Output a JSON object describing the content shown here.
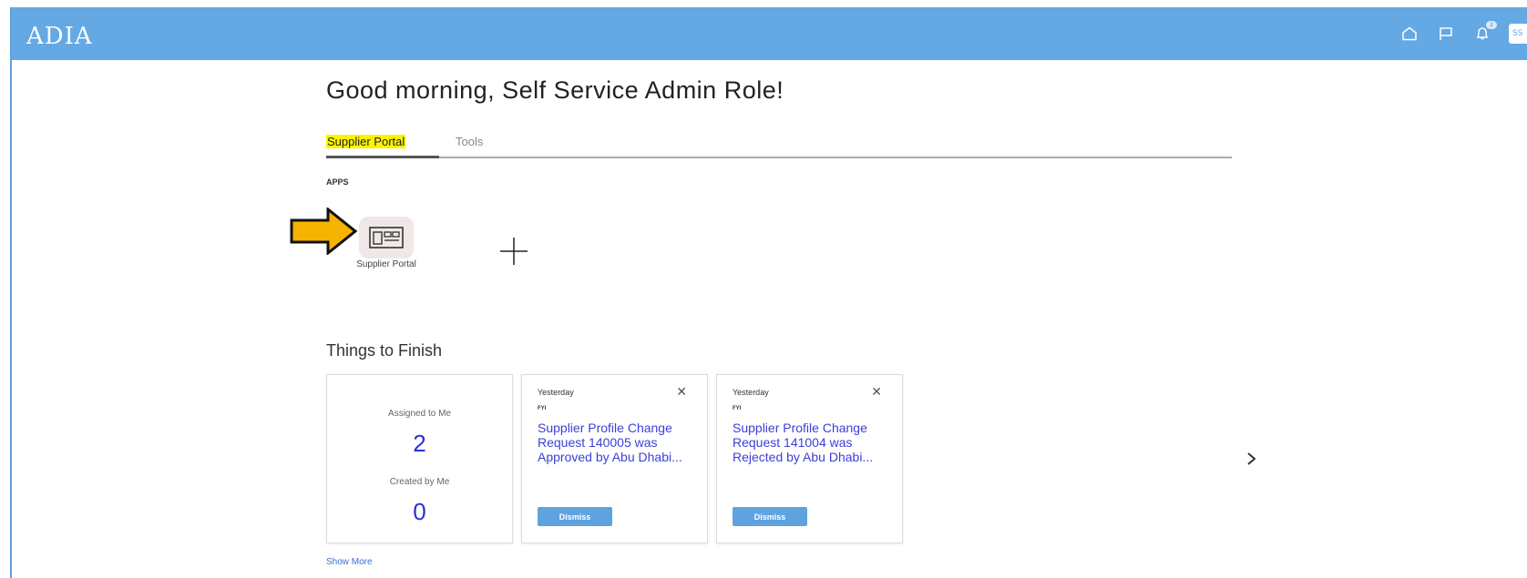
{
  "header": {
    "logo": "ADIA",
    "avatar_initials": "SS",
    "notification_count": "2",
    "icons": [
      "home-icon",
      "flag-icon",
      "bell-icon"
    ]
  },
  "greeting": "Good morning, Self Service Admin Role!",
  "tabs": [
    {
      "label": "Supplier Portal",
      "active": true
    },
    {
      "label": "Tools",
      "active": false
    }
  ],
  "apps": {
    "section_label": "APPS",
    "items": [
      {
        "label": "Supplier Portal",
        "icon": "supplier-portal-icon"
      }
    ],
    "add_icon": "plus-icon"
  },
  "things_to_finish": {
    "title": "Things to Finish",
    "summary": {
      "assigned_label": "Assigned to Me",
      "assigned_count": "2",
      "created_label": "Created by Me",
      "created_count": "0"
    },
    "notifications": [
      {
        "when": "Yesterday",
        "type": "FYI",
        "text": "Supplier Profile Change Request 140005 was Approved by Abu Dhabi...",
        "button": "Dismiss"
      },
      {
        "when": "Yesterday",
        "type": "FYI",
        "text": "Supplier Profile Change Request 141004 was Rejected by Abu Dhabi...",
        "button": "Dismiss"
      }
    ],
    "show_more": "Show More"
  },
  "colors": {
    "header": "#64a8e4",
    "highlight": "#fbf300",
    "arrow": "#f5b300",
    "link": "#3a3fd8",
    "button": "#5ea3e0"
  }
}
